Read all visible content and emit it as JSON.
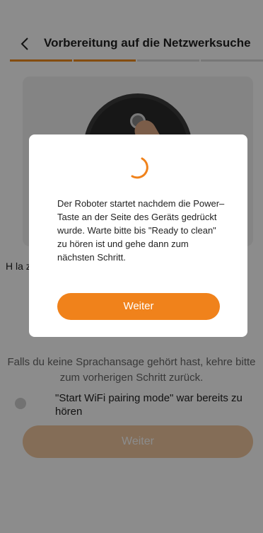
{
  "header": {
    "title": "Vorbereitung auf die Netzwerksuche",
    "back_icon": "chevron-left-icon"
  },
  "progress": {
    "steps_total": 4,
    "steps_completed": 2
  },
  "main": {
    "instruction_visible": "H la zi a",
    "hint": "Falls du keine Sprachansage gehört hast, kehre bitte zum vorherigen Schritt zurück.",
    "checkbox_label": "\"Start WiFi pairing mode\" war bereits zu hören",
    "button_label": "Weiter"
  },
  "dialog": {
    "message": "Der Roboter startet nachdem die Power–Taste an der Seite des Geräts gedrückt wurde. Warte bitte bis \"Ready to clean\" zu hören ist und gehe dann zum nächsten Schritt.",
    "button_label": "Weiter",
    "spinner_icon": "spinner-icon"
  },
  "colors": {
    "accent": "#f0821b",
    "accent_disabled": "#f0c79f",
    "overlay": "rgba(0,0,0,0.45)"
  }
}
